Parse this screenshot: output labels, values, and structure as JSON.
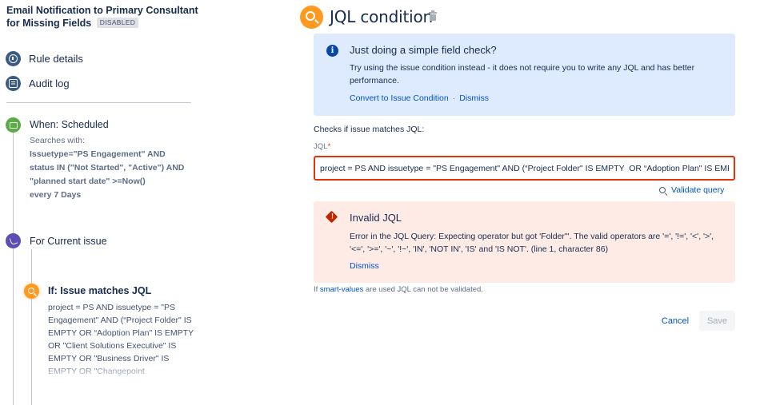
{
  "sidebar": {
    "rule_title": "Email Notification to Primary Consultant for Missing Fields",
    "status_badge": "DISABLED",
    "nav": [
      {
        "label": "Rule details",
        "icon": "info-icon"
      },
      {
        "label": "Audit log",
        "icon": "list-icon"
      }
    ],
    "trigger": {
      "title": "When: Scheduled",
      "detail_intro": "Searches with:",
      "detail_query": "Issuetype=\"PS Engagement\" AND status IN (\"Not Started\", \"Active\") AND \"planned start date\" >=Now()",
      "detail_schedule": "every 7 Days",
      "icon": "calendar-icon"
    },
    "branch": {
      "title": "For Current issue",
      "icon": "branch-icon"
    },
    "condition": {
      "title": "If: Issue matches JQL",
      "body": "project = PS AND issuetype = \"PS Engagement\" AND (“Project Folder\" IS EMPTY OR “Adoption Plan\" IS EMPTY OR \"Client Solutions Executive\" IS EMPTY OR \"Business Driver\" IS EMPTY OR \"Changepoint",
      "icon": "search-icon"
    }
  },
  "main": {
    "title": "JQL condition",
    "info": {
      "title": "Just doing a simple field check?",
      "text": "Try using the issue condition instead - it does not require you to write any JQL and has better performance.",
      "convert_link": "Convert to Issue Condition",
      "separator": "·",
      "dismiss_link": "Dismiss"
    },
    "checks_label": "Checks if issue matches JQL:",
    "jql_label": "JQL",
    "jql_required": "*",
    "jql_value": "project = PS AND issuetype = \"PS Engagement\" AND (“Project Folder\" IS EMPTY  OR “Adoption Plan\" IS EMPTY OR \"Client Solutions Executive\" IS EMPTY OR \"Business Driver\" IS EMPTY OR \"Changepoint",
    "validate_label": "Validate query",
    "error": {
      "title": "Invalid JQL",
      "text": "Error in the JQL Query: Expecting operator but got 'Folder\"'. The valid operators are '=', '!=', '<', '>', '<=', '>=', '~', '!~', 'IN', 'NOT IN', 'IS' and 'IS NOT'. (line 1, character 86)",
      "dismiss_link": "Dismiss"
    },
    "smart_note_prefix": "If ",
    "smart_note_link": "smart-values",
    "smart_note_suffix": " are used JQL can not be validated.",
    "cancel_label": "Cancel",
    "save_label": "Save"
  },
  "colors": {
    "accent": "#0052cc",
    "error": "#de350b",
    "info_bg": "#deebff",
    "error_bg": "#ffebe6",
    "condition_orange": "#ff991f",
    "trigger_green": "#5aac44",
    "branch_purple": "#5e4db2"
  }
}
